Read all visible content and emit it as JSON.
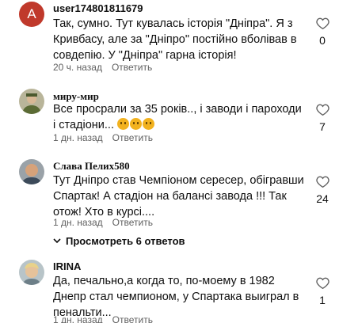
{
  "comments": [
    {
      "author": "user174801811679",
      "avatar_letter": "A",
      "text": "Так, сумно. Тут кувалась історія \"Дніпра\". Я з Кривбасу, але за \"Дніпро\" постійно вболівав в совдепію. У \"Дніпра\" гарна історія!",
      "time": "20 ч. назад",
      "reply": "Ответить",
      "likes": "0"
    },
    {
      "author": "миру-мир",
      "text": "Все просрали за 35 років.., і заводи і пароходи і стадіони...",
      "time": "1 дн. назад",
      "reply": "Ответить",
      "likes": "7"
    },
    {
      "author": "Слава Пелих580",
      "text": "Тут Дніпро став Чемпіоном сересер, обігравши Спартак! А стадіон на балансі завода !!! Так отож! Хто в курсі....",
      "time": "1 дн. назад",
      "reply": "Ответить",
      "likes": "24",
      "replies_label": "Просмотреть 6 ответов"
    },
    {
      "author": "IRINA",
      "text": "Да, печально,а когда то, по-моему в 1982 Днепр стал чемпионом, у Спартака выиграл в пенальти...",
      "time": "1 дн. назад",
      "reply": "Ответить",
      "likes": "1"
    }
  ]
}
